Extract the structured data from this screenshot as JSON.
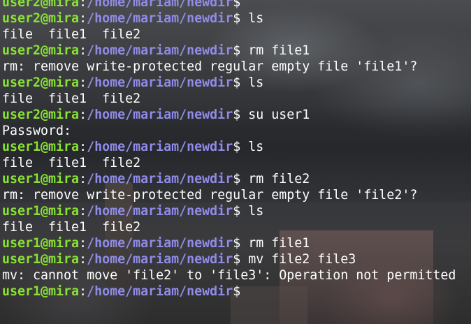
{
  "colors": {
    "prompt_user": "#8ae234",
    "prompt_path": "#8f8ce8",
    "text": "#ffffff"
  },
  "terminal": {
    "lines": [
      {
        "kind": "prompt",
        "user": "user2@mira",
        "colon": ":",
        "path": "/home/mariam/newdir",
        "sign": "$ ",
        "cmd": ""
      },
      {
        "kind": "prompt",
        "user": "user2@mira",
        "colon": ":",
        "path": "/home/mariam/newdir",
        "sign": "$ ",
        "cmd": "ls"
      },
      {
        "kind": "output",
        "text": "file  file1  file2"
      },
      {
        "kind": "prompt",
        "user": "user2@mira",
        "colon": ":",
        "path": "/home/mariam/newdir",
        "sign": "$ ",
        "cmd": "rm file1"
      },
      {
        "kind": "output",
        "text": "rm: remove write-protected regular empty file 'file1'?"
      },
      {
        "kind": "prompt",
        "user": "user2@mira",
        "colon": ":",
        "path": "/home/mariam/newdir",
        "sign": "$ ",
        "cmd": "ls"
      },
      {
        "kind": "output",
        "text": "file  file1  file2"
      },
      {
        "kind": "prompt",
        "user": "user2@mira",
        "colon": ":",
        "path": "/home/mariam/newdir",
        "sign": "$ ",
        "cmd": "su user1"
      },
      {
        "kind": "output",
        "text": "Password:"
      },
      {
        "kind": "prompt",
        "user": "user1@mira",
        "colon": ":",
        "path": "/home/mariam/newdir",
        "sign": "$ ",
        "cmd": "ls"
      },
      {
        "kind": "output",
        "text": "file  file1  file2"
      },
      {
        "kind": "prompt",
        "user": "user1@mira",
        "colon": ":",
        "path": "/home/mariam/newdir",
        "sign": "$ ",
        "cmd": "rm file2"
      },
      {
        "kind": "output",
        "text": "rm: remove write-protected regular empty file 'file2'?"
      },
      {
        "kind": "prompt",
        "user": "user1@mira",
        "colon": ":",
        "path": "/home/mariam/newdir",
        "sign": "$ ",
        "cmd": "ls"
      },
      {
        "kind": "output",
        "text": "file  file1  file2"
      },
      {
        "kind": "prompt",
        "user": "user1@mira",
        "colon": ":",
        "path": "/home/mariam/newdir",
        "sign": "$ ",
        "cmd": "rm file1"
      },
      {
        "kind": "prompt",
        "user": "user1@mira",
        "colon": ":",
        "path": "/home/mariam/newdir",
        "sign": "$ ",
        "cmd": "mv file2 file3"
      },
      {
        "kind": "output",
        "text": "mv: cannot move 'file2' to 'file3': Operation not permitted"
      },
      {
        "kind": "prompt",
        "user": "user1@mira",
        "colon": ":",
        "path": "/home/mariam/newdir",
        "sign": "$",
        "cmd": ""
      }
    ]
  }
}
